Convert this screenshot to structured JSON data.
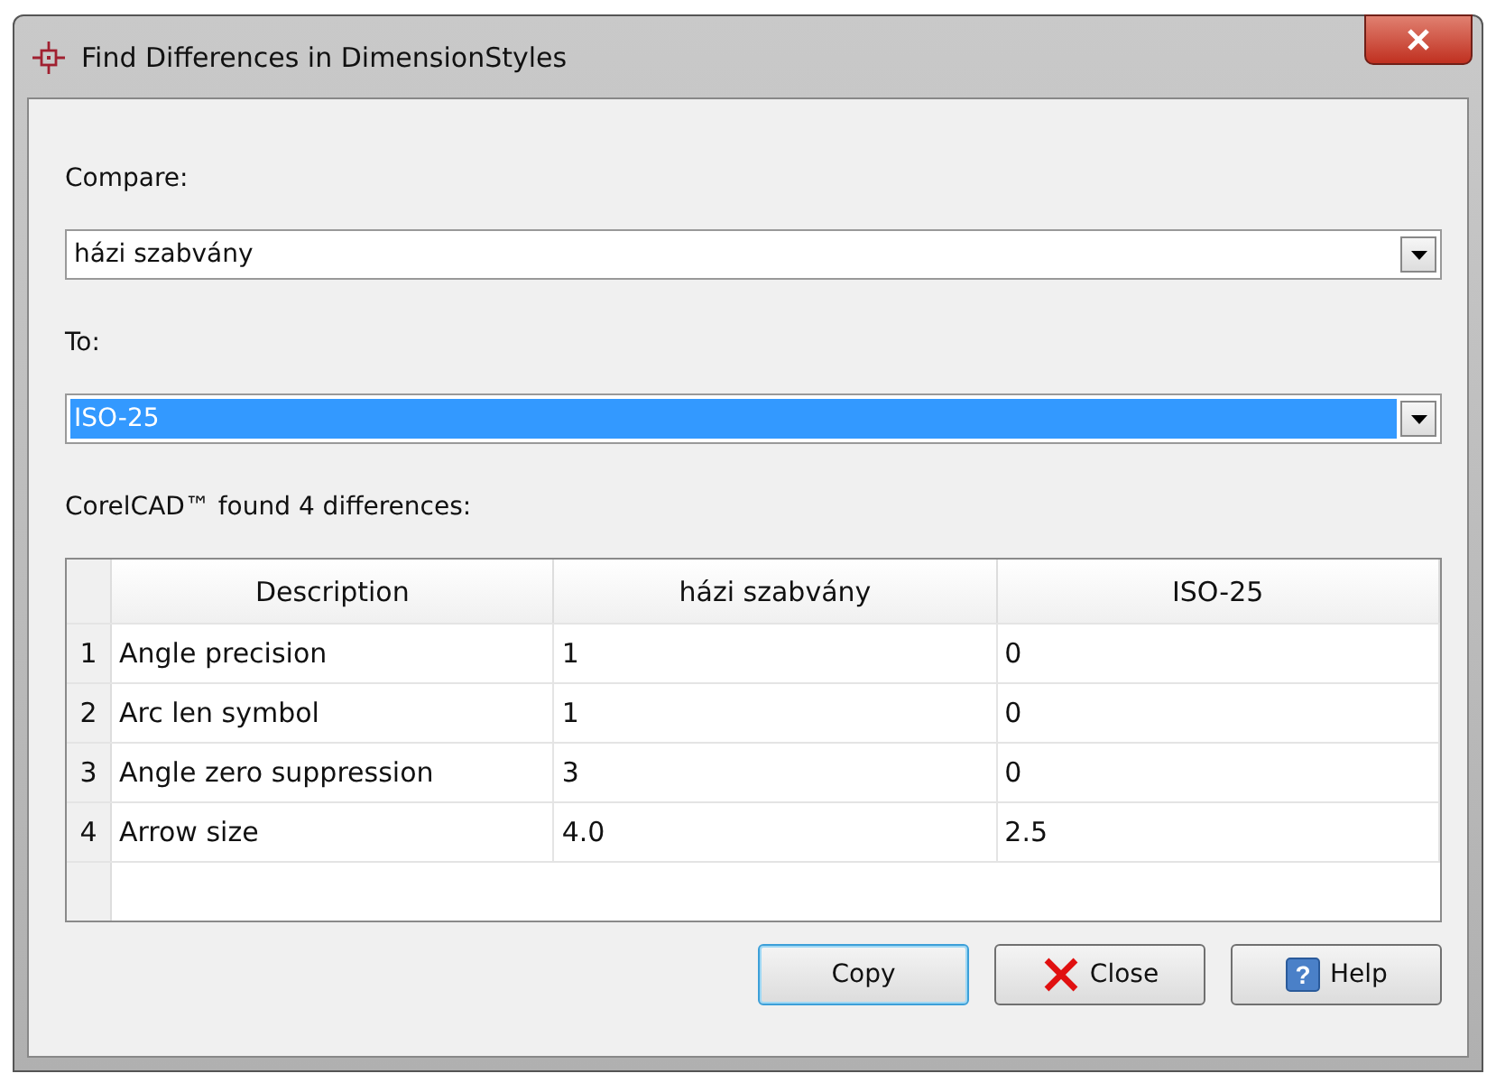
{
  "window": {
    "title": "Find Differences in DimensionStyles"
  },
  "compare": {
    "label": "Compare:",
    "value": "házi szabvány",
    "selected": false
  },
  "to": {
    "label": "To:",
    "value": "ISO-25",
    "selected": true
  },
  "summary": "CorelCAD™ found 4 differences:",
  "table": {
    "columns": [
      "Description",
      "házi szabvány",
      "ISO-25"
    ],
    "rows": [
      {
        "number": "1",
        "cells": [
          "Angle precision",
          "1",
          "0"
        ]
      },
      {
        "number": "2",
        "cells": [
          "Arc len symbol",
          "1",
          "0"
        ]
      },
      {
        "number": "3",
        "cells": [
          "Angle zero suppression",
          "3",
          "0"
        ]
      },
      {
        "number": "4",
        "cells": [
          "Arrow size",
          "4.0",
          "2.5"
        ]
      }
    ]
  },
  "buttons": [
    {
      "label": "Copy",
      "kind": "default"
    },
    {
      "label": "Close",
      "kind": "close"
    },
    {
      "label": "Help",
      "kind": "help",
      "icon_text": "?"
    }
  ]
}
